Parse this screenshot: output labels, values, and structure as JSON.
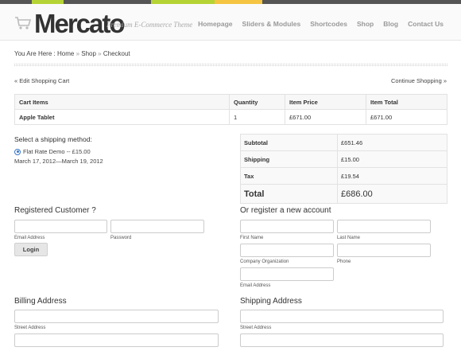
{
  "colors": {
    "topbar": [
      "#555555",
      "#b5d334",
      "#555555",
      "#b5d334",
      "#f5c542",
      "#555555"
    ],
    "accent": "#3a78c8"
  },
  "header": {
    "logo_icon": "shopping-cart-icon",
    "logo_text": "Mercato",
    "tagline": "Premium E-Commerce Theme",
    "nav": [
      "Homepage",
      "Sliders & Modules",
      "Shortcodes",
      "Shop",
      "Blog",
      "Contact Us"
    ]
  },
  "breadcrumb": {
    "prefix": "You Are Here :",
    "home": "Home",
    "shop": "Shop",
    "current": "Checkout",
    "sep": "»"
  },
  "cart_links": {
    "edit": "« Edit Shopping Cart",
    "continue": "Continue Shopping »"
  },
  "cart_table": {
    "headers": [
      "Cart Items",
      "Quantity",
      "Item Price",
      "Item Total"
    ],
    "rows": [
      [
        "Apple Tablet",
        "1",
        "£671.00",
        "£671.00"
      ]
    ]
  },
  "shipping": {
    "title": "Select a shipping method:",
    "option": "Flat Rate Demo -- £15.00",
    "dates": "March 17, 2012—March 19, 2012"
  },
  "totals": [
    {
      "label": "Subtotal",
      "value": "£651.46"
    },
    {
      "label": "Shipping",
      "value": "£15.00"
    },
    {
      "label": "Tax",
      "value": "£19.54"
    },
    {
      "label": "Total",
      "value": "£686.00"
    }
  ],
  "registered": {
    "title": "Registered Customer ?",
    "email_label": "Email Address",
    "password_label": "Password",
    "login": "Login"
  },
  "register": {
    "title": "Or register a new account",
    "first_name": "First Name",
    "last_name": "Last Name",
    "company": "Company Organization",
    "phone": "Phone",
    "email": "Email Address"
  },
  "billing": {
    "title": "Billing Address",
    "street": "Street Address"
  },
  "shipping_address": {
    "title": "Shipping Address",
    "street": "Street Address"
  }
}
